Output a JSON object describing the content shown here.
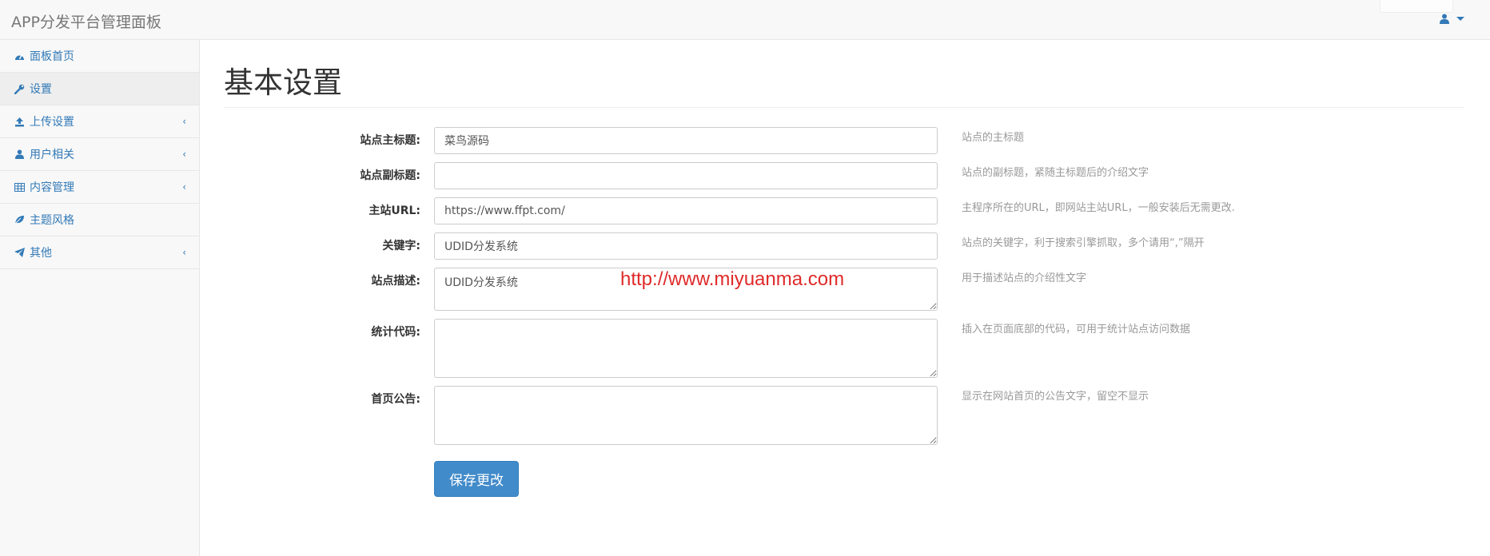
{
  "navbar": {
    "brand": "APP分发平台管理面板"
  },
  "sidebar": {
    "items": [
      {
        "label": "面板首页",
        "icon": "dashboard-icon",
        "has_arrow": false,
        "active": false
      },
      {
        "label": "设置",
        "icon": "wrench-icon",
        "has_arrow": false,
        "active": true
      },
      {
        "label": "上传设置",
        "icon": "upload-icon",
        "has_arrow": true,
        "active": false
      },
      {
        "label": "用户相关",
        "icon": "user-icon",
        "has_arrow": true,
        "active": false
      },
      {
        "label": "内容管理",
        "icon": "table-icon",
        "has_arrow": true,
        "active": false
      },
      {
        "label": "主题风格",
        "icon": "leaf-icon",
        "has_arrow": false,
        "active": false
      },
      {
        "label": "其他",
        "icon": "paper-plane-icon",
        "has_arrow": true,
        "active": false
      }
    ]
  },
  "page": {
    "title": "基本设置"
  },
  "form": {
    "site_title": {
      "label": "站点主标题:",
      "value": "菜鸟源码",
      "help": "站点的主标题"
    },
    "site_subtitle": {
      "label": "站点副标题:",
      "value": "",
      "help": "站点的副标题，紧随主标题后的介绍文字"
    },
    "site_url": {
      "label": "主站URL:",
      "value": "https://www.ffpt.com/",
      "help": "主程序所在的URL，即网站主站URL，一般安装后无需更改."
    },
    "keywords": {
      "label": "关键字:",
      "value": "UDID分发系统",
      "help": "站点的关键字，利于搜索引擎抓取，多个请用“,”隔开"
    },
    "description": {
      "label": "站点描述:",
      "value": "UDID分发系统",
      "help": "用于描述站点的介绍性文字"
    },
    "stats_code": {
      "label": "统计代码:",
      "value": "",
      "help": "插入在页面底部的代码，可用于统计站点访问数据"
    },
    "announcement": {
      "label": "首页公告:",
      "value": "",
      "help": "显示在网站首页的公告文字，留空不显示"
    },
    "save_label": "保存更改"
  },
  "watermark": "http://www.miyuanma.com",
  "colors": {
    "link": "#337ab7",
    "primary_button": "#428bca",
    "watermark": "#e02a2a"
  }
}
